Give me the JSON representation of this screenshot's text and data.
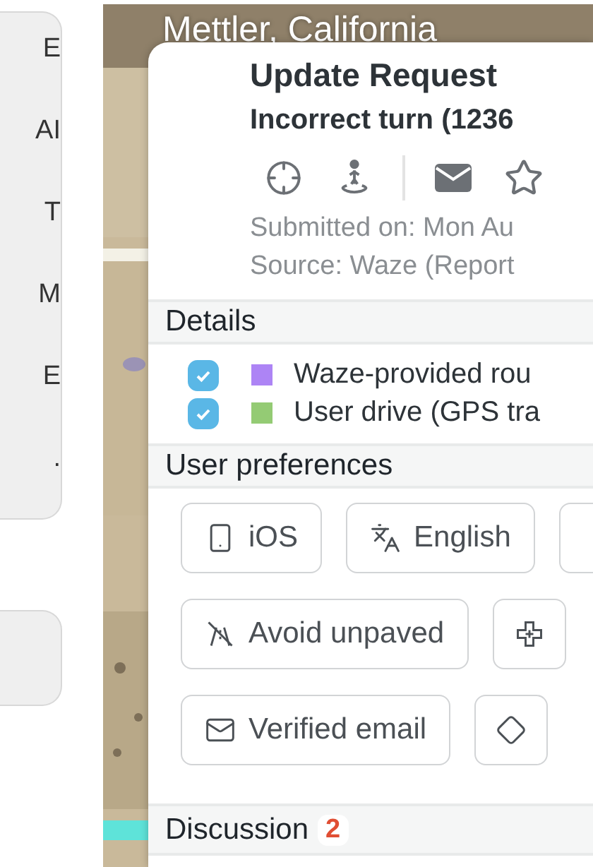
{
  "sidebar": {
    "items": [
      {
        "label": "E"
      },
      {
        "label": "AI"
      },
      {
        "label": "T"
      },
      {
        "label": "M"
      },
      {
        "label": "E"
      },
      {
        "label": "."
      }
    ]
  },
  "map": {
    "place": "Mettler, California"
  },
  "popup": {
    "title": "Update Request",
    "subtitle": "Incorrect turn (1236",
    "actions": [
      {
        "kind": "crosshair"
      },
      {
        "kind": "person-pin"
      },
      {
        "kind": "envelope"
      },
      {
        "kind": "star"
      }
    ],
    "meta": [
      "Submitted on: Mon Au",
      "Source: Waze (Report"
    ],
    "details": {
      "heading": "Details",
      "layers": [
        {
          "label": "Waze-provided rou",
          "checked": true,
          "color": "#ad84f5"
        },
        {
          "label": "User drive (GPS tra",
          "checked": true,
          "color": "#94cb74"
        }
      ]
    },
    "preferences": {
      "heading": "User preferences",
      "rows": [
        [
          {
            "kind": "phone",
            "label": "iOS"
          },
          {
            "kind": "language",
            "label": "English"
          },
          {
            "kind": "blank"
          }
        ],
        [
          {
            "kind": "avoid",
            "label": "Avoid unpaved"
          },
          {
            "kind": "plus"
          }
        ],
        [
          {
            "kind": "email",
            "label": "Verified email"
          },
          {
            "kind": "diamond"
          }
        ]
      ]
    },
    "discussion": {
      "heading": "Discussion",
      "count": "2"
    }
  }
}
